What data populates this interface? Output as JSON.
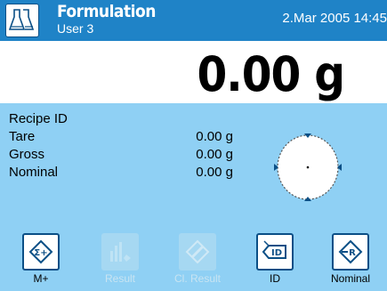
{
  "header": {
    "app_icon": "flask-icon",
    "title": "Formulation",
    "user": "User 3",
    "datetime": "2.Mar 2005  14:45"
  },
  "display": {
    "weight": "0.00 g"
  },
  "info": {
    "rows": [
      {
        "label": "Recipe ID",
        "value": ""
      },
      {
        "label": "Tare",
        "value": "0.00 g"
      },
      {
        "label": "Gross",
        "value": "0.00 g"
      },
      {
        "label": "Nominal",
        "value": "0.00 g"
      }
    ]
  },
  "target": {
    "icon": "target-circle-icon"
  },
  "function_keys": [
    {
      "label": "M+",
      "icon": "sum-icon",
      "enabled": true
    },
    {
      "label": "Result",
      "icon": "result-icon",
      "enabled": false
    },
    {
      "label": "Cl. Result",
      "icon": "clear-result-icon",
      "enabled": false
    },
    {
      "label": "ID",
      "icon": "id-tag-icon",
      "enabled": true
    },
    {
      "label": "Nominal",
      "icon": "nominal-icon",
      "enabled": true
    }
  ],
  "colors": {
    "header_bg": "#1f83c7",
    "info_bg": "#8fd0f4",
    "button_border": "#0b4f86"
  }
}
